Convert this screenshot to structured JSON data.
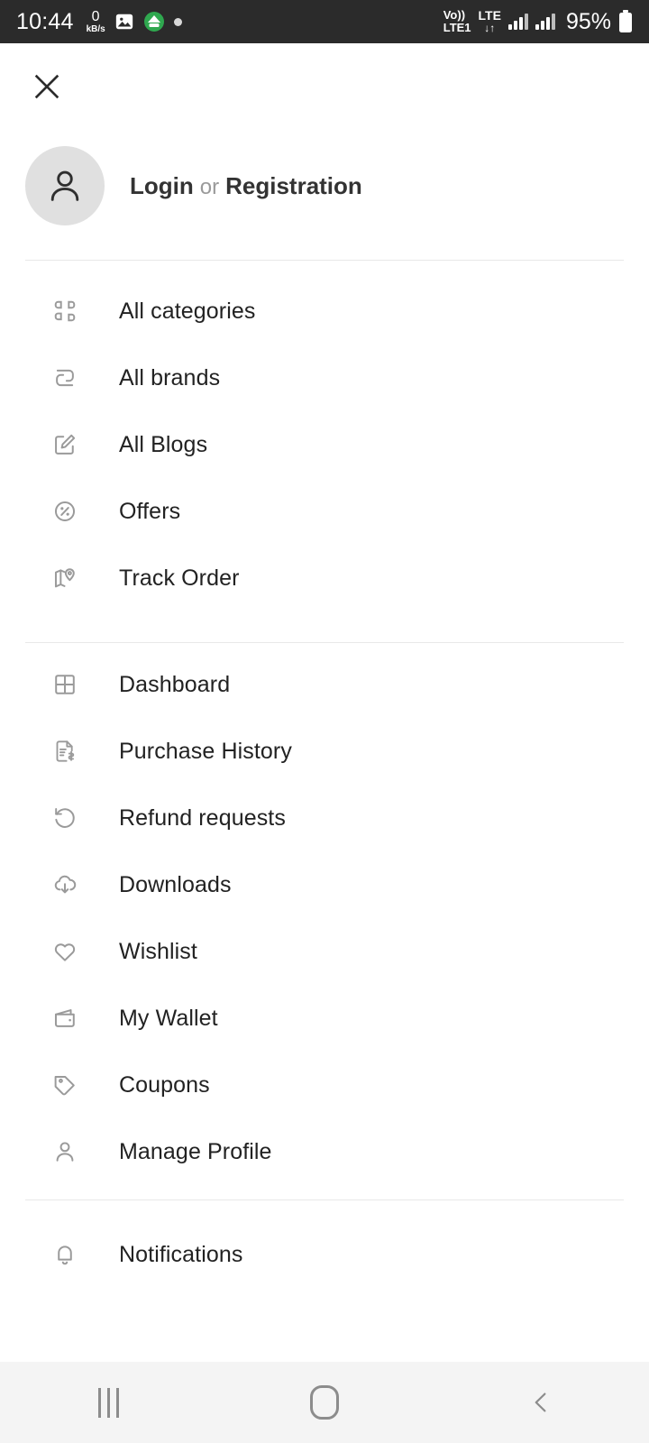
{
  "status_bar": {
    "time": "10:44",
    "net_speed_value": "0",
    "net_speed_unit": "kB/s",
    "image_icon": "image-icon",
    "app_icon": "green-app-icon",
    "dot_icon": "dot-icon",
    "volte_line1": "Vo))",
    "volte_line2": "LTE1",
    "lte_line1": "LTE",
    "lte_line2": "↓↑",
    "signal_icon_1": "signal-bars-icon",
    "signal_icon_2": "signal-bars-icon",
    "battery_percent": "95%",
    "battery_icon": "battery-icon",
    "background_color": "#2b2b2b"
  },
  "header": {
    "close_icon": "close-icon",
    "avatar_icon": "user-avatar-icon",
    "login_label": "Login",
    "or_label": "or",
    "registration_label": "Registration"
  },
  "menu": {
    "group_1": [
      {
        "icon": "grid-squares-icon",
        "label": "All categories"
      },
      {
        "icon": "brand-tag-icon",
        "label": "All brands"
      },
      {
        "icon": "edit-square-icon",
        "label": "All Blogs"
      },
      {
        "icon": "percent-circle-icon",
        "label": "Offers"
      },
      {
        "icon": "map-pin-icon",
        "label": "Track Order"
      }
    ],
    "group_2": [
      {
        "icon": "dashboard-grid-icon",
        "label": "Dashboard"
      },
      {
        "icon": "invoice-dollar-icon",
        "label": "Purchase History"
      },
      {
        "icon": "rotate-back-icon",
        "label": "Refund requests"
      },
      {
        "icon": "cloud-download-icon",
        "label": "Downloads"
      },
      {
        "icon": "heart-icon",
        "label": "Wishlist"
      },
      {
        "icon": "wallet-icon",
        "label": "My Wallet"
      },
      {
        "icon": "coupon-tag-icon",
        "label": "Coupons"
      },
      {
        "icon": "person-icon",
        "label": "Manage Profile"
      }
    ],
    "group_3": [
      {
        "icon": "bell-icon",
        "label": "Notifications"
      }
    ]
  },
  "nav_bar": {
    "recents_icon": "recents-icon",
    "home_icon": "home-icon",
    "back_icon": "back-chevron-icon",
    "background_color": "#f4f4f4"
  },
  "colors": {
    "icon_gray": "#9a9a9a",
    "text_dark": "#222222",
    "divider": "#e8e8e8",
    "avatar_bg": "#e0e0e0"
  }
}
